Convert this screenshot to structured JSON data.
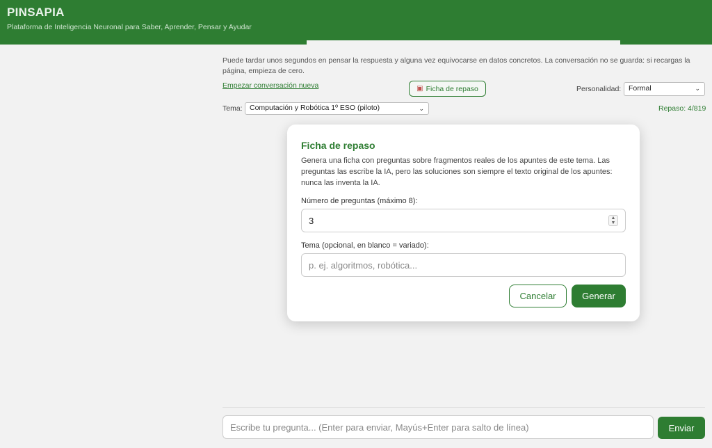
{
  "header": {
    "title": "PINSAPIA",
    "subtitle": "Plataforma de Inteligencia Neuronal para Saber, Aprender, Pensar y Ayudar"
  },
  "chat": {
    "info": "Puede tardar unos segundos en pensar la respuesta y alguna vez equivocarse en datos concretos. La conversación no se guarda: si recargas la página, empieza de cero.",
    "new_conversation": "Empezar conversación nueva",
    "ficha_button": "Ficha de repaso",
    "personality_label": "Personalidad:",
    "personality_value": "Formal",
    "tema_label": "Tema:",
    "tema_value": "Computación y Robótica 1º ESO (piloto)",
    "repaso_status": "Repaso: 4/819",
    "ask_placeholder": "Escribe tu pregunta... (Enter para enviar, Mayús+Enter para salto de línea)",
    "send_label": "Enviar"
  },
  "modal": {
    "title": "Ficha de repaso",
    "description": "Genera una ficha con preguntas sobre fragmentos reales de los apuntes de este tema. Las preguntas las escribe la IA, pero las soluciones son siempre el texto original de los apuntes: nunca las inventa la IA.",
    "num_label": "Número de preguntas (máximo 8):",
    "num_value": "3",
    "tema_label": "Tema (opcional, en blanco = variado):",
    "tema_placeholder": "p. ej. algoritmos, robótica...",
    "cancel_label": "Cancelar",
    "generate_label": "Generar"
  },
  "colors": {
    "brand": "#2e7d32",
    "overlay": "rgba(0,0,0,0.05)"
  }
}
